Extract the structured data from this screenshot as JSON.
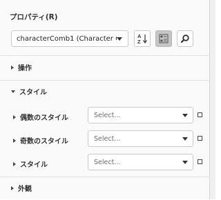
{
  "header": {
    "title": "プロパティ(R)"
  },
  "object_selector": {
    "value": "characterComb1 (Character C..."
  },
  "toolbar": {
    "sort_icon": "sort-alphabetical-icon",
    "categorized_icon": "categorized-list-icon",
    "search_icon": "search-icon"
  },
  "sections": {
    "operation": {
      "label": "操作"
    },
    "style": {
      "label": "スタイル",
      "items": [
        {
          "label": "偶数のスタイル",
          "placeholder": "Select..."
        },
        {
          "label": "奇数のスタイル",
          "placeholder": "Select..."
        },
        {
          "label": "スタイル",
          "placeholder": "Select..."
        }
      ]
    },
    "appearance": {
      "label": "外観"
    }
  }
}
